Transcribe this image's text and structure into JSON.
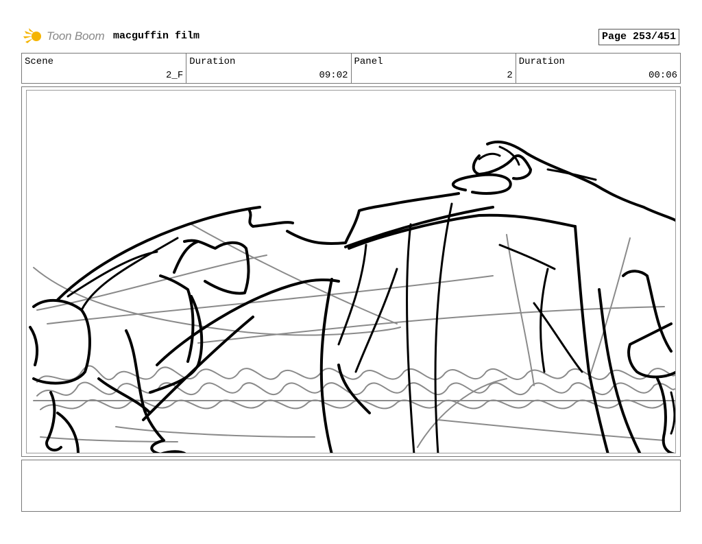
{
  "header": {
    "brand": "Toon Boom",
    "project_title": "macguffin film",
    "page_label": "Page 253/451"
  },
  "info": {
    "scene_label": "Scene",
    "scene_value": "2_F",
    "scene_duration_label": "Duration",
    "scene_duration_value": "09:02",
    "panel_label": "Panel",
    "panel_value": "2",
    "panel_duration_label": "Duration",
    "panel_duration_value": "00:06"
  },
  "notes": {
    "text": ""
  },
  "colors": {
    "logo_accent": "#f5b400",
    "logo_text": "#888888",
    "sketch_dark": "#000000",
    "sketch_light": "#8a8a8a"
  }
}
